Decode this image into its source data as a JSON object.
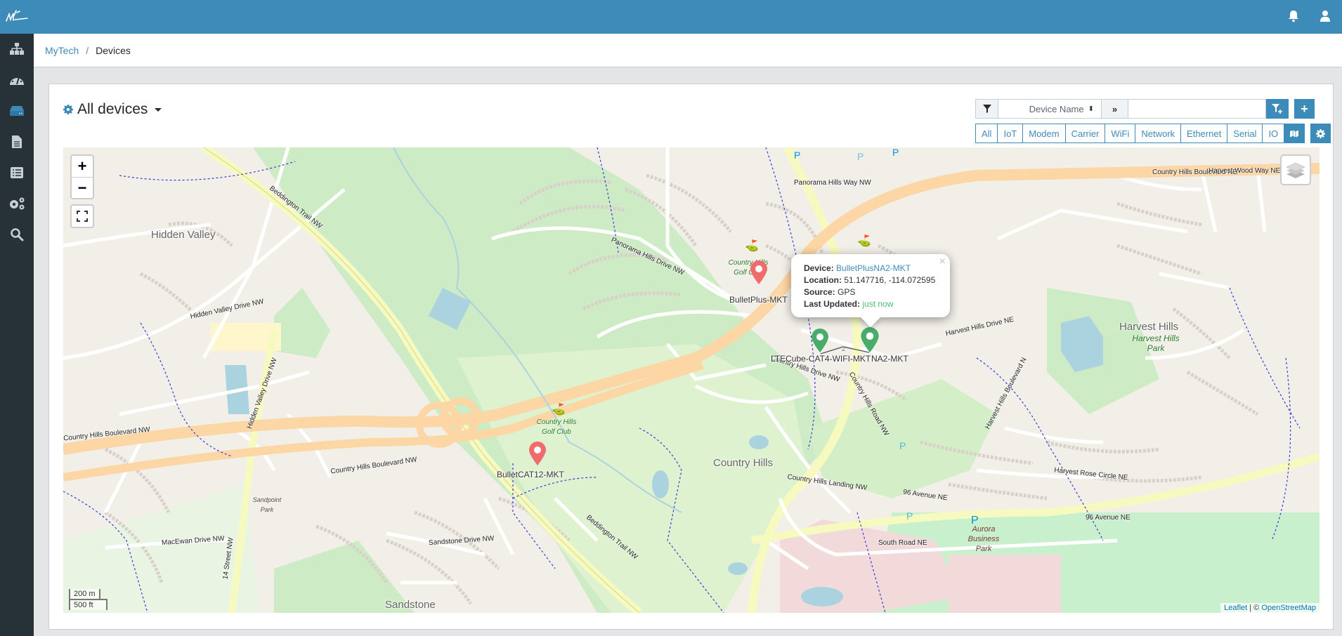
{
  "app": {
    "logo": "mi-logo",
    "top_icons": [
      "bell-icon",
      "user-icon"
    ]
  },
  "sidebar": {
    "items": [
      {
        "name": "network-topology",
        "icon": "sitemap-icon",
        "active": false
      },
      {
        "name": "dashboard",
        "icon": "tachometer-icon",
        "active": false
      },
      {
        "name": "devices",
        "icon": "hdd-icon",
        "active": true
      },
      {
        "name": "reports",
        "icon": "file-icon",
        "active": false
      },
      {
        "name": "list",
        "icon": "list-icon",
        "active": false
      },
      {
        "name": "settings",
        "icon": "cogs-icon",
        "active": false
      },
      {
        "name": "search",
        "icon": "search-icon",
        "active": false
      }
    ]
  },
  "breadcrumb": {
    "root": "MyTech",
    "separator": "/",
    "current": "Devices"
  },
  "header": {
    "title": "All devices"
  },
  "filter": {
    "field_select": "Device Name",
    "search_value": "",
    "add_filter_label": "add-filter",
    "add_device_label": "+"
  },
  "type_tabs": [
    "All",
    "IoT",
    "Modem",
    "Carrier",
    "WiFi",
    "Network",
    "Ethernet",
    "Serial",
    "IO"
  ],
  "map": {
    "zoom_in": "+",
    "zoom_out": "−",
    "scale_metric": "200 m",
    "scale_imperial": "500 ft",
    "attribution_leaflet": "Leaflet",
    "attribution_sep": " | © ",
    "attribution_osm": "OpenStreetMap",
    "markers": [
      {
        "label": "BulletPlus-MKT",
        "color": "#f06b6b",
        "status": "offline"
      },
      {
        "label": "LTECube-CAT4-WIFI-MKT",
        "color": "#4aac6b",
        "status": "online"
      },
      {
        "label": "NA2-MKT",
        "color": "#4aac6b",
        "status": "online"
      },
      {
        "label": "BulletCAT12-MKT",
        "color": "#f06b6b",
        "status": "offline"
      }
    ],
    "cluster_count": "2",
    "popup": {
      "device_label": "Device:",
      "device_value": "BulletPlusNA2-MKT",
      "location_label": "Location:",
      "location_value": "51.147716, -114.072595",
      "source_label": "Source:",
      "source_value": "GPS",
      "updated_label": "Last Updated:",
      "updated_value": "just now",
      "close": "×"
    },
    "places": {
      "hidden_valley": "Hidden Valley",
      "country_hills": "Country Hills",
      "harvest_hills": "Harvest Hills",
      "harvest_hills_park": "Harvest Hills Park",
      "sandstone": "Sandstone",
      "aurora_park": "Aurora Business Park",
      "golf_club_1": "Country Hills Golf Club",
      "golf_club_2": "Country Hills Golf Club",
      "sandpoint_park": "Sandpoint Park"
    },
    "roads": {
      "r1": "Country Hills Boulevard NW",
      "r2": "Country Hills Boulevard NW",
      "r3": "Country Hills Boulevard NE",
      "r4": "Beddington Trail NW",
      "r5": "Beddington Trail NW",
      "r6": "Harvest Hills Boulevard N",
      "r7": "96 Avenue NE",
      "r8": "96 Avenue NE",
      "r9": "14 Street NW",
      "r10": "Hidden Valley Drive NW",
      "r11": "Panorama Hills Way NW",
      "r12": "Country Hills Drive NW",
      "r13": "Country Hills Road NW",
      "r14": "Harvest Hills Drive NE",
      "r15": "MacEwan Drive NW",
      "r16": "Sandstone Drive NW",
      "r17": "South Road NE",
      "r18": "Country Hills Landing NW",
      "r19": "Harvest Rose Circle NE",
      "r20": "Harvest Wood Way NE",
      "r21": "Panorama Hills Drive NW",
      "r22": "Hidden Valley Drive NW"
    }
  }
}
